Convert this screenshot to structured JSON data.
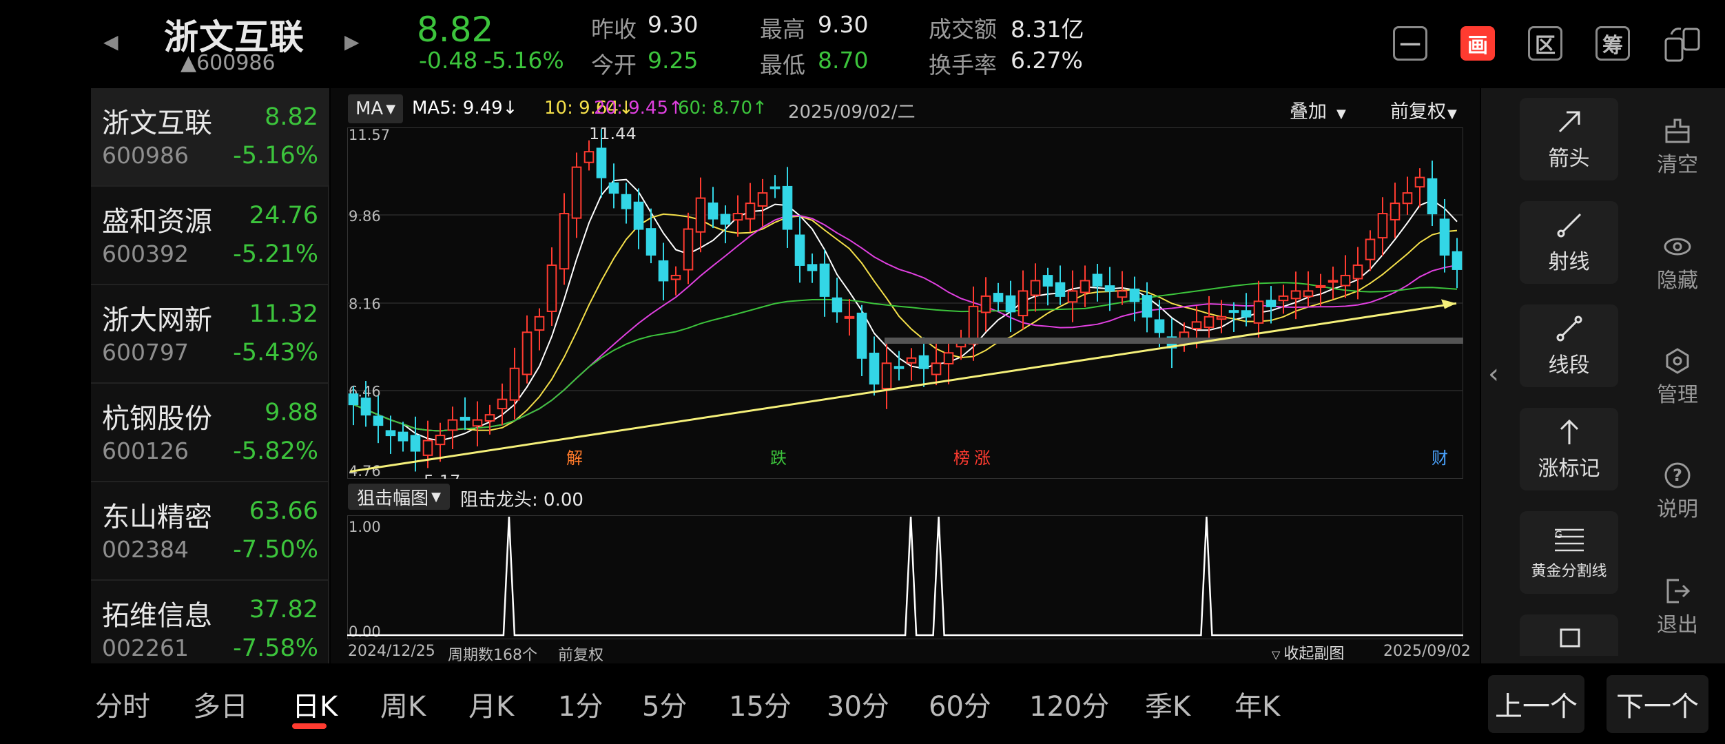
{
  "header": {
    "stock_name": "浙文互联",
    "stock_code": "▲600986",
    "price": "8.82",
    "change": "-0.48",
    "change_pct": "-5.16%",
    "prev_close_label": "昨收",
    "prev_close": "9.30",
    "open_label": "今开",
    "open": "9.25",
    "high_label": "最高",
    "high": "9.30",
    "low_label": "最低",
    "low": "8.70",
    "turnover_label": "成交额",
    "turnover": "8.31亿",
    "turnover_rate_label": "换手率",
    "turnover_rate": "6.27%",
    "toolbar": [
      "一",
      "画",
      "区",
      "筹"
    ]
  },
  "watchlist": [
    {
      "name": "浙文互联",
      "code": "600986",
      "price": "8.82",
      "pct": "-5.16%"
    },
    {
      "name": "盛和资源",
      "code": "600392",
      "price": "24.76",
      "pct": "-5.21%"
    },
    {
      "name": "浙大网新",
      "code": "600797",
      "price": "11.32",
      "pct": "-5.43%"
    },
    {
      "name": "杭钢股份",
      "code": "600126",
      "price": "9.88",
      "pct": "-5.82%"
    },
    {
      "name": "东山精密",
      "code": "002384",
      "price": "63.66",
      "pct": "-7.50%"
    },
    {
      "name": "拓维信息",
      "code": "002261",
      "price": "37.82",
      "pct": "-7.58%"
    }
  ],
  "chart": {
    "ma_button": "MA",
    "ma5": "MA5: 9.49↓",
    "ma10": "10: 9.64↓",
    "ma20": "20: 9.45↑",
    "ma60": "60: 8.70↑",
    "date": "2025/09/02/二",
    "overlay": "叠加",
    "adjust": "前复权",
    "y_labels": [
      "11.57",
      "9.86",
      "8.16",
      "6.46",
      "4.76"
    ],
    "max_label": "11.44",
    "min_label": "5.17",
    "events": [
      "解",
      "跌",
      "榜",
      "涨",
      "财"
    ],
    "sub_indicator": "狙击幅图",
    "sub_value": "阻击龙头: 0.00",
    "sub_y": [
      "1.00",
      "0.00"
    ],
    "start_date": "2024/12/25",
    "period_count": "周期数168个",
    "adjust_footer": "前复权",
    "collapse": "收起副图",
    "end_date": "2025/09/02",
    "colors": {
      "ma5": "#ffffff",
      "ma10": "#f5e04a",
      "ma20": "#e040e0",
      "ma60": "#3cc43c",
      "up": "#ff3b30",
      "down": "#33d6e6",
      "trend": "#f5f07a"
    }
  },
  "chart_data": {
    "type": "candlestick",
    "ylim": [
      4.76,
      11.57
    ],
    "y_ticks": [
      11.57,
      9.86,
      8.16,
      6.46,
      4.76
    ],
    "closes": [
      6.2,
      6.0,
      5.8,
      5.6,
      5.5,
      5.3,
      5.5,
      5.6,
      5.9,
      5.9,
      5.9,
      6.0,
      6.3,
      6.9,
      7.6,
      7.9,
      8.9,
      9.9,
      10.8,
      11.1,
      10.6,
      10.3,
      10.0,
      9.6,
      9.1,
      8.6,
      8.7,
      9.6,
      10.2,
      9.8,
      9.7,
      9.9,
      10.1,
      10.3,
      10.4,
      9.6,
      8.9,
      8.8,
      8.3,
      8.0,
      7.9,
      7.1,
      6.6,
      7.0,
      6.9,
      7.1,
      6.9,
      7.0,
      7.2,
      7.4,
      8.1,
      8.3,
      8.2,
      8.0,
      8.4,
      8.6,
      8.5,
      8.3,
      8.4,
      8.6,
      8.5,
      8.4,
      8.4,
      8.2,
      7.9,
      7.6,
      7.3,
      7.6,
      7.8,
      7.9,
      7.9,
      8.0,
      7.9,
      8.2,
      8.1,
      8.3,
      8.4,
      8.4,
      8.5,
      8.6,
      8.7,
      8.9,
      9.4,
      9.9,
      10.1,
      10.3,
      10.6,
      9.9,
      9.1,
      8.82
    ],
    "sub_spikes": [
      0.145,
      0.505,
      0.53,
      0.77
    ],
    "sub_ylim": [
      0,
      1
    ]
  },
  "tools": [
    {
      "label": "箭头",
      "icon": "arrow-icon"
    },
    {
      "label": "射线",
      "icon": "ray-icon"
    },
    {
      "label": "线段",
      "icon": "segment-icon"
    },
    {
      "label": "涨标记",
      "icon": "up-mark-icon"
    },
    {
      "label": "黄金分割线",
      "icon": "golden-ratio-icon"
    }
  ],
  "side": [
    {
      "label": "清空",
      "icon": "clear-icon"
    },
    {
      "label": "隐藏",
      "icon": "eye-icon"
    },
    {
      "label": "管理",
      "icon": "manage-icon"
    },
    {
      "label": "说明",
      "icon": "help-icon"
    },
    {
      "label": "退出",
      "icon": "exit-icon"
    }
  ],
  "periods": [
    "分时",
    "多日",
    "日K",
    "周K",
    "月K",
    "1分",
    "5分",
    "15分",
    "30分",
    "60分",
    "120分",
    "季K",
    "年K"
  ],
  "selected_period": "日K",
  "prev_button": "上一个",
  "next_button": "下一个"
}
